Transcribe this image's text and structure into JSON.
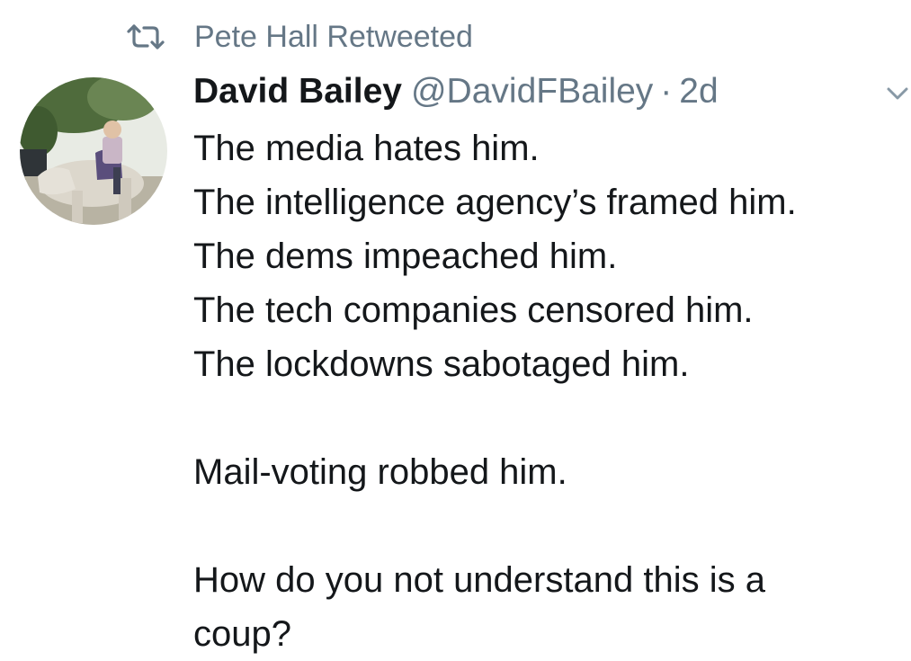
{
  "retweet": {
    "icon": "retweet-icon",
    "text": "Pete Hall Retweeted"
  },
  "tweet": {
    "avatar": "user-avatar",
    "display_name": "David Bailey",
    "handle": "@DavidFBailey",
    "separator": "·",
    "time": "2d",
    "menu_icon": "chevron-down-icon",
    "lines": [
      "The media hates him.",
      "The intelligence agency’s framed him.",
      "The dems impeached him.",
      "The tech companies censored him.",
      "The lockdowns sabotaged him.",
      "",
      "Mail-voting robbed him.",
      "",
      "How do you not understand this is a",
      "coup?"
    ]
  },
  "colors": {
    "text": "#14171a",
    "secondary": "#657786",
    "background": "#ffffff"
  }
}
